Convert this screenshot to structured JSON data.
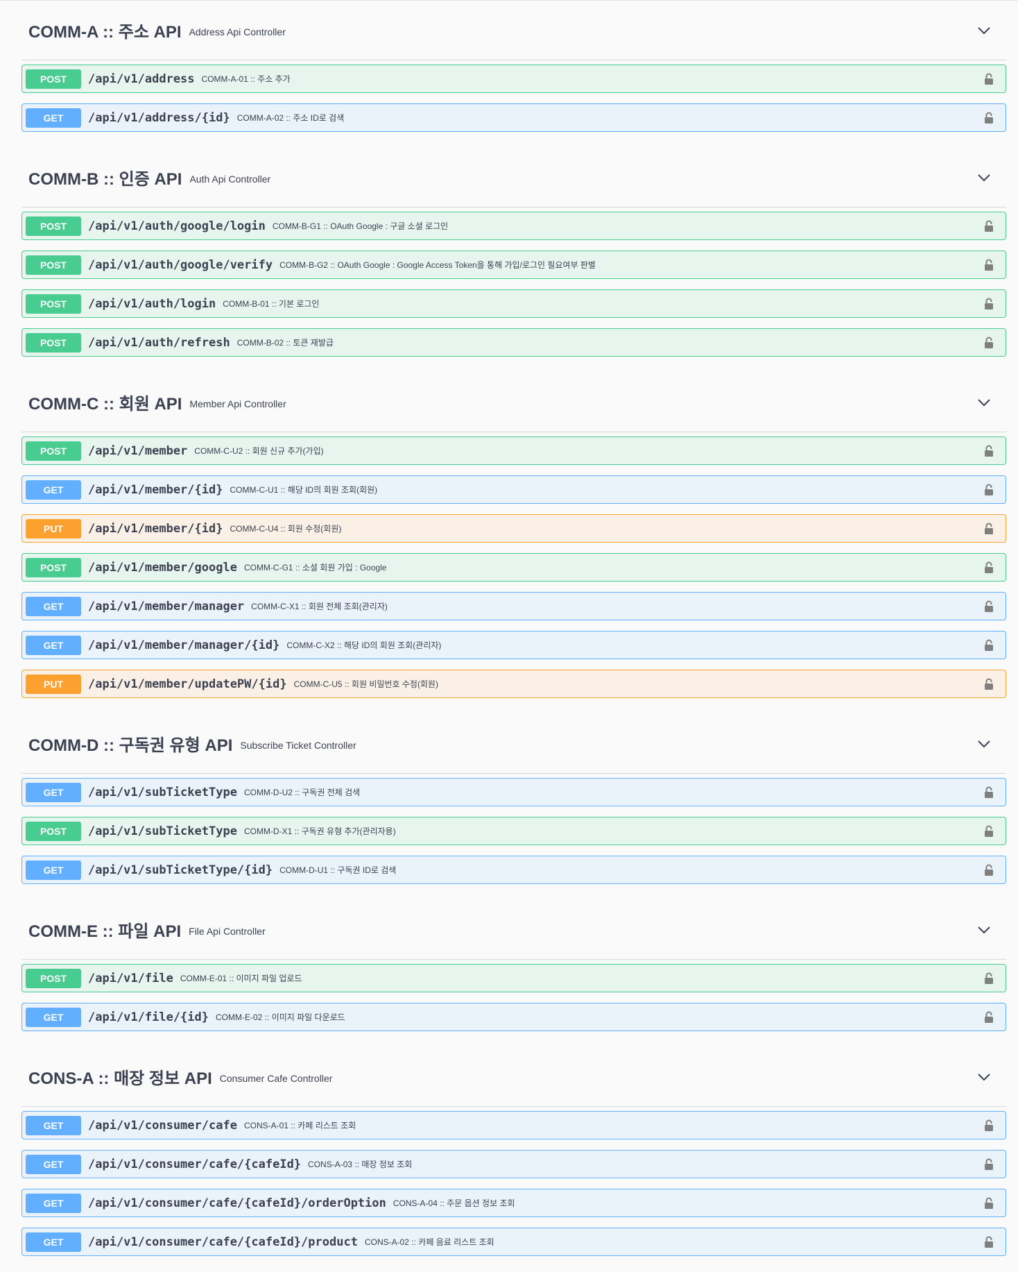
{
  "sections": [
    {
      "title": "COMM-A :: 주소 API",
      "description": "Address Api Controller",
      "operations": [
        {
          "method": "POST",
          "path": "/api/v1/address",
          "summary": "COMM-A-01 :: 주소 추가"
        },
        {
          "method": "GET",
          "path": "/api/v1/address/{id}",
          "summary": "COMM-A-02 :: 주소 ID로 검색"
        }
      ]
    },
    {
      "title": "COMM-B :: 인증 API",
      "description": "Auth Api Controller",
      "operations": [
        {
          "method": "POST",
          "path": "/api/v1/auth/google/login",
          "summary": "COMM-B-G1 :: OAuth Google : 구글 소셜 로그인"
        },
        {
          "method": "POST",
          "path": "/api/v1/auth/google/verify",
          "summary": "COMM-B-G2 :: OAuth Google : Google Access Token을 통해 가입/로그인 필요여부 판별"
        },
        {
          "method": "POST",
          "path": "/api/v1/auth/login",
          "summary": "COMM-B-01 :: 기본 로그인"
        },
        {
          "method": "POST",
          "path": "/api/v1/auth/refresh",
          "summary": "COMM-B-02 :: 토큰 재발급"
        }
      ]
    },
    {
      "title": "COMM-C :: 회원 API",
      "description": "Member Api Controller",
      "operations": [
        {
          "method": "POST",
          "path": "/api/v1/member",
          "summary": "COMM-C-U2 :: 회원 신규 추가(가입)"
        },
        {
          "method": "GET",
          "path": "/api/v1/member/{id}",
          "summary": "COMM-C-U1 :: 해당 ID의 회원 조회(회원)"
        },
        {
          "method": "PUT",
          "path": "/api/v1/member/{id}",
          "summary": "COMM-C-U4 :: 회원 수정(회원)"
        },
        {
          "method": "POST",
          "path": "/api/v1/member/google",
          "summary": "COMM-C-G1 :: 소셜 회원 가입 : Google"
        },
        {
          "method": "GET",
          "path": "/api/v1/member/manager",
          "summary": "COMM-C-X1 :: 회원 전체 조회(관리자)"
        },
        {
          "method": "GET",
          "path": "/api/v1/member/manager/{id}",
          "summary": "COMM-C-X2 :: 해당 ID의 회원 조회(관리자)"
        },
        {
          "method": "PUT",
          "path": "/api/v1/member/updatePW/{id}",
          "summary": "COMM-C-U5 :: 회원 비밀번호 수정(회원)"
        }
      ]
    },
    {
      "title": "COMM-D :: 구독권 유형 API",
      "description": "Subscribe Ticket Controller",
      "operations": [
        {
          "method": "GET",
          "path": "/api/v1/subTicketType",
          "summary": "COMM-D-U2 :: 구독권 전체 검색"
        },
        {
          "method": "POST",
          "path": "/api/v1/subTicketType",
          "summary": "COMM-D-X1 :: 구독권 유형 추가(관리자용)"
        },
        {
          "method": "GET",
          "path": "/api/v1/subTicketType/{id}",
          "summary": "COMM-D-U1 :: 구독권 ID로 검색"
        }
      ]
    },
    {
      "title": "COMM-E :: 파일 API",
      "description": "File Api Controller",
      "operations": [
        {
          "method": "POST",
          "path": "/api/v1/file",
          "summary": "COMM-E-01 :: 이미지 파일 업로드"
        },
        {
          "method": "GET",
          "path": "/api/v1/file/{id}",
          "summary": "COMM-E-02 :: 이미지 파일 다운로드"
        }
      ]
    },
    {
      "title": "CONS-A :: 매장 정보 API",
      "description": "Consumer Cafe Controller",
      "operations": [
        {
          "method": "GET",
          "path": "/api/v1/consumer/cafe",
          "summary": "CONS-A-01 :: 카페 리스트 조회"
        },
        {
          "method": "GET",
          "path": "/api/v1/consumer/cafe/{cafeId}",
          "summary": "CONS-A-03 :: 매장 정보 조회"
        },
        {
          "method": "GET",
          "path": "/api/v1/consumer/cafe/{cafeId}/orderOption",
          "summary": "CONS-A-04 :: 주문 옵션 정보 조회"
        },
        {
          "method": "GET",
          "path": "/api/v1/consumer/cafe/{cafeId}/product",
          "summary": "CONS-A-02 :: 카페 음료 리스트 조회"
        }
      ]
    }
  ],
  "icons": {
    "section_toggle": "chevron-down-icon",
    "operation_auth": "lock-icon"
  },
  "colors": {
    "post": "#49cc90",
    "get": "#61affe",
    "put": "#fca130",
    "text": "#3b4151"
  }
}
